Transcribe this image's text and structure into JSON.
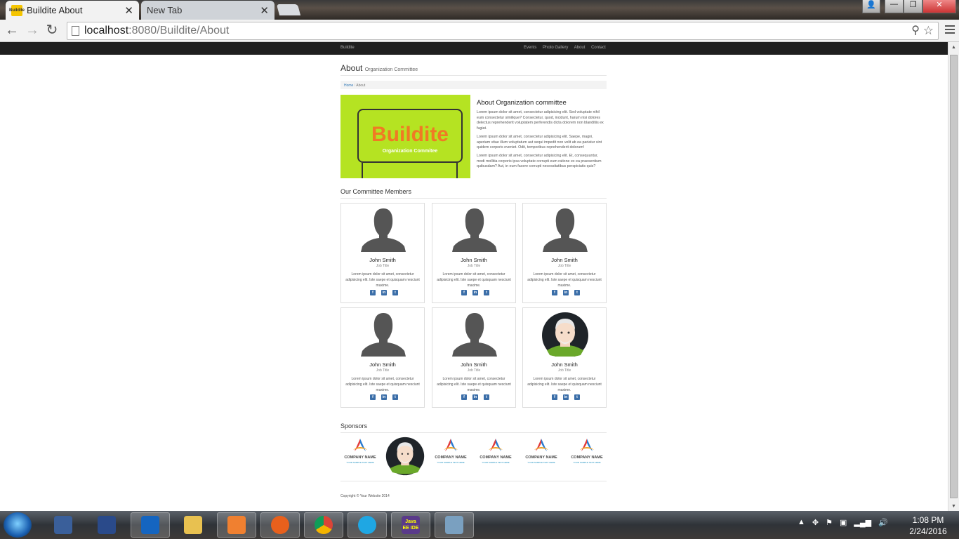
{
  "browser": {
    "tabs": [
      {
        "title": "Buildite About",
        "favicon": "Buildite"
      },
      {
        "title": "New Tab"
      }
    ],
    "url_host": "localhost",
    "url_path": ":8080/Buildite/About"
  },
  "site": {
    "brand": "Buildite",
    "nav": [
      "Events",
      "Photo Gallery",
      "About",
      "Contact"
    ],
    "heading": "About",
    "subheading": "Organization Committee",
    "breadcrumb": {
      "home": "Home",
      "sep": "/",
      "current": "About"
    },
    "banner": {
      "title": "Buildite",
      "subtitle": "Organization Commitee",
      "bg_color": "#b5e322",
      "title_color": "#f07a24"
    },
    "about_title": "About Organization committee",
    "paragraphs": [
      "Lorem ipsum dolor sit amet, consectetur adipisicing elit. Sed voluptate nihil eum consectetur similique? Consectetur, quod, incidunt, harum nisi dolores delectus reprehenderit voluptatem perferendis dicta dolorem non blanditiis ex fugiat.",
      "Lorem ipsum dolor sit amet, consectetur adipisicing elit. Saepe, magni, aperiam vitae illum voluptatum aut sequi impedit non velit ab ea pariatur sint quidem corporis eveniet. Odit, temporibus reprehenderit dolorum!",
      "Lorem ipsum dolor sit amet, consectetur adipisicing elit. Et, consequuntur, modi mollitia corporis ipsa voluptate corrupti eum ratione ex ea praesentium quibusdam? Aut, in eum facere corrupti necessitatibus perspiciatis quis?"
    ],
    "members_heading": "Our Committee Members",
    "members": [
      {
        "name": "John Smith",
        "job": "Job Title",
        "desc": "Lorem ipsum dolor sit amet, consectetur adipisicing elit. Iste saepe et quisquam nesciunt maxime.",
        "avatar": "silhouette-icon"
      },
      {
        "name": "John Smith",
        "job": "Job Title",
        "desc": "Lorem ipsum dolor sit amet, consectetur adipisicing elit. Iste saepe et quisquam nesciunt maxime.",
        "avatar": "silhouette-icon"
      },
      {
        "name": "John Smith",
        "job": "Job Title",
        "desc": "Lorem ipsum dolor sit amet, consectetur adipisicing elit. Iste saepe et quisquam nesciunt maxime.",
        "avatar": "silhouette-icon"
      },
      {
        "name": "John Smith",
        "job": "Job Title",
        "desc": "Lorem ipsum dolor sit amet, consectetur adipisicing elit. Iste saepe et quisquam nesciunt maxime.",
        "avatar": "silhouette-icon"
      },
      {
        "name": "John Smith",
        "job": "Job Title",
        "desc": "Lorem ipsum dolor sit amet, consectetur adipisicing elit. Iste saepe et quisquam nesciunt maxime.",
        "avatar": "silhouette-icon"
      },
      {
        "name": "John Smith",
        "job": "Job Title",
        "desc": "Lorem ipsum dolor sit amet, consectetur adipisicing elit. Iste saepe et quisquam nesciunt maxime.",
        "avatar": "old-man-avatar-icon"
      }
    ],
    "sponsors_heading": "Sponsors",
    "sponsors": [
      {
        "name": "COMPANY NAME",
        "tagline": "YOUR SAMPLE TEXT HERE"
      },
      {
        "name": "",
        "tagline": "",
        "avatar": "old-man-avatar-icon"
      },
      {
        "name": "COMPANY NAME",
        "tagline": "YOUR SAMPLE TEXT HERE"
      },
      {
        "name": "COMPANY NAME",
        "tagline": "YOUR SAMPLE TEXT HERE"
      },
      {
        "name": "COMPANY NAME",
        "tagline": "YOUR SAMPLE TEXT HERE"
      },
      {
        "name": "COMPANY NAME",
        "tagline": "YOUR SAMPLE TEXT HERE"
      }
    ],
    "copyright": "Copyright © Your Website 2014"
  },
  "taskbar": {
    "apps": [
      "laptop-icon",
      "network-icon",
      "outlook-icon",
      "explorer-icon",
      "media-icon",
      "firefox-icon",
      "chrome-icon",
      "skype-icon",
      "java-ee-ide-icon",
      "paint-icon"
    ],
    "java_label": "Java EE IDE",
    "clock_time": "1:08 PM",
    "clock_date": "2/24/2016"
  }
}
